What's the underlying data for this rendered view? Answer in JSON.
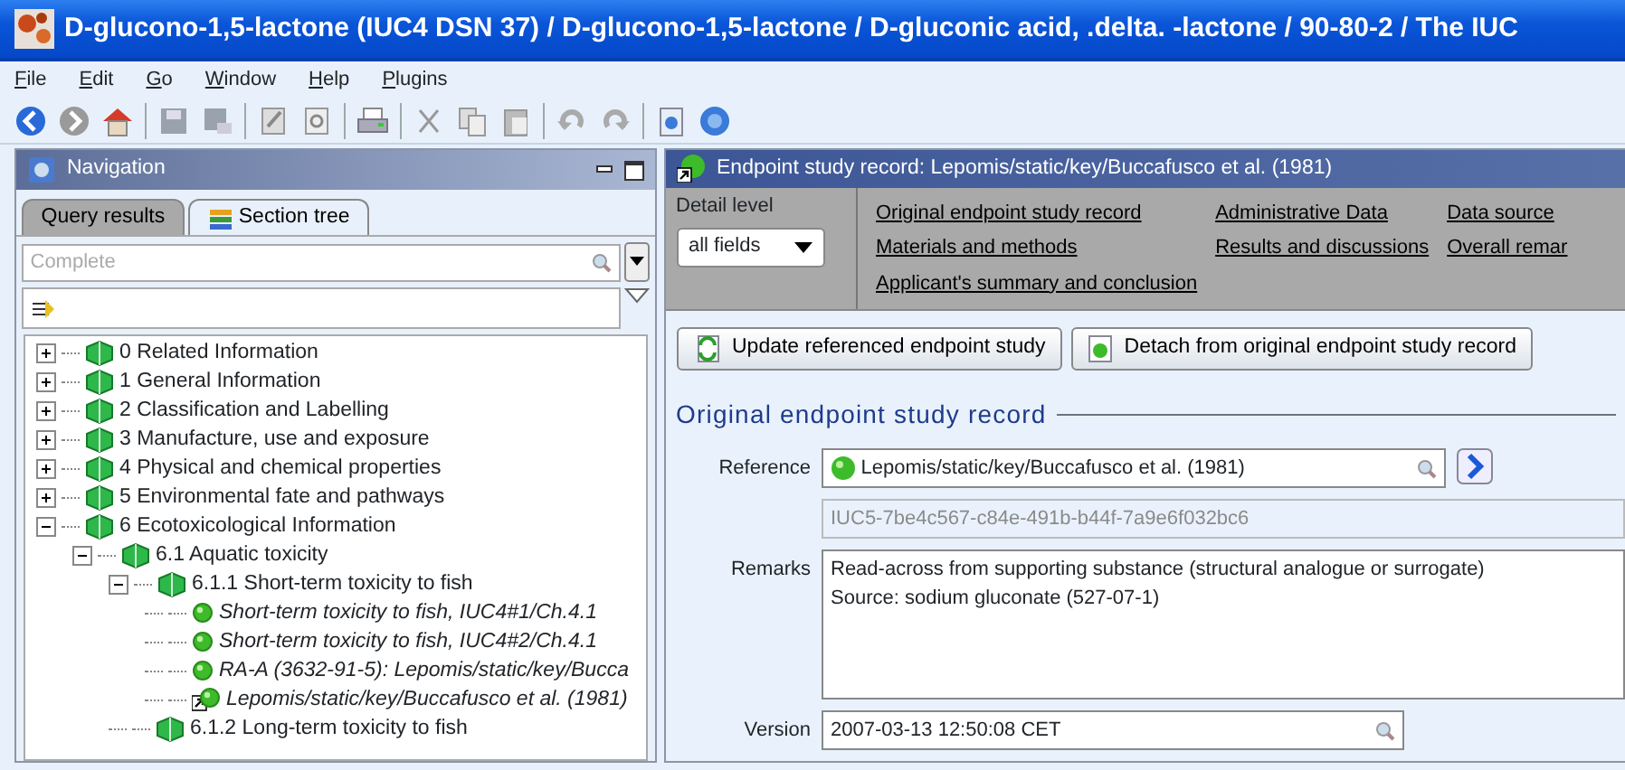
{
  "window": {
    "title": "D-glucono-1,5-lactone (IUC4 DSN 37) / D-glucono-1,5-lactone / D-gluconic acid, .delta. -lactone / 90-80-2 / The IUC"
  },
  "menu": [
    "File",
    "Edit",
    "Go",
    "Window",
    "Help",
    "Plugins"
  ],
  "navigation": {
    "title": "Navigation",
    "tabs": [
      {
        "label": "Query results",
        "selected": false
      },
      {
        "label": "Section tree",
        "selected": true
      }
    ],
    "filter": {
      "placeholder": "Complete"
    },
    "tree": [
      {
        "kind": "section",
        "label": "0 Related Information",
        "expanded": false
      },
      {
        "kind": "section",
        "label": "1 General Information",
        "expanded": false
      },
      {
        "kind": "section",
        "label": "2 Classification and Labelling",
        "expanded": false
      },
      {
        "kind": "section",
        "label": "3 Manufacture, use and exposure",
        "expanded": false
      },
      {
        "kind": "section",
        "label": "4 Physical and chemical properties",
        "expanded": false
      },
      {
        "kind": "section",
        "label": "5 Environmental fate and pathways",
        "expanded": false
      },
      {
        "kind": "section",
        "label": "6 Ecotoxicological Information",
        "expanded": true,
        "children": [
          {
            "kind": "section",
            "label": "6.1 Aquatic toxicity",
            "expanded": true,
            "children": [
              {
                "kind": "section",
                "label": "6.1.1 Short-term toxicity to fish",
                "expanded": true,
                "children": [
                  {
                    "kind": "record",
                    "label": "Short-term toxicity to fish, IUC4#1/Ch.4.1",
                    "shortcut": false
                  },
                  {
                    "kind": "record",
                    "label": "Short-term toxicity to fish, IUC4#2/Ch.4.1",
                    "shortcut": false
                  },
                  {
                    "kind": "record",
                    "label": "RA-A (3632-91-5): Lepomis/static/key/Bucca",
                    "shortcut": false
                  },
                  {
                    "kind": "record",
                    "label": "Lepomis/static/key/Buccafusco et al. (1981)",
                    "shortcut": true
                  }
                ]
              },
              {
                "kind": "section",
                "label": "6.1.2 Long-term toxicity to fish"
              }
            ]
          }
        ]
      }
    ]
  },
  "record": {
    "title": "Endpoint study record: Lepomis/static/key/Buccafusco et al. (1981)",
    "detail_level": {
      "label": "Detail level",
      "value": "all fields"
    },
    "links": [
      "Original endpoint study record",
      "Administrative Data",
      "Data source",
      "Materials and methods",
      "Results and discussions",
      "Overall remar",
      "Applicant's summary and conclusion"
    ],
    "buttons": [
      {
        "kind": "update",
        "label": "Update referenced endpoint study"
      },
      {
        "kind": "detach",
        "label": "Detach from original endpoint study record"
      }
    ],
    "section_title": "Original endpoint study record",
    "fields": [
      {
        "kind": "reference",
        "label": "Reference",
        "value": "Lepomis/static/key/Buccafusco et al. (1981)"
      },
      {
        "kind": "readonly",
        "value": "IUC5-7be4c567-c84e-491b-b44f-7a9e6f032bc6"
      },
      {
        "kind": "memo",
        "label": "Remarks",
        "lines": [
          "Read-across from supporting substance (structural analogue or surrogate)",
          "Source: sodium gluconate (527-07-1)"
        ]
      },
      {
        "kind": "lookup",
        "label": "Version",
        "value": "2007-03-13 12:50:08 CET"
      }
    ]
  }
}
